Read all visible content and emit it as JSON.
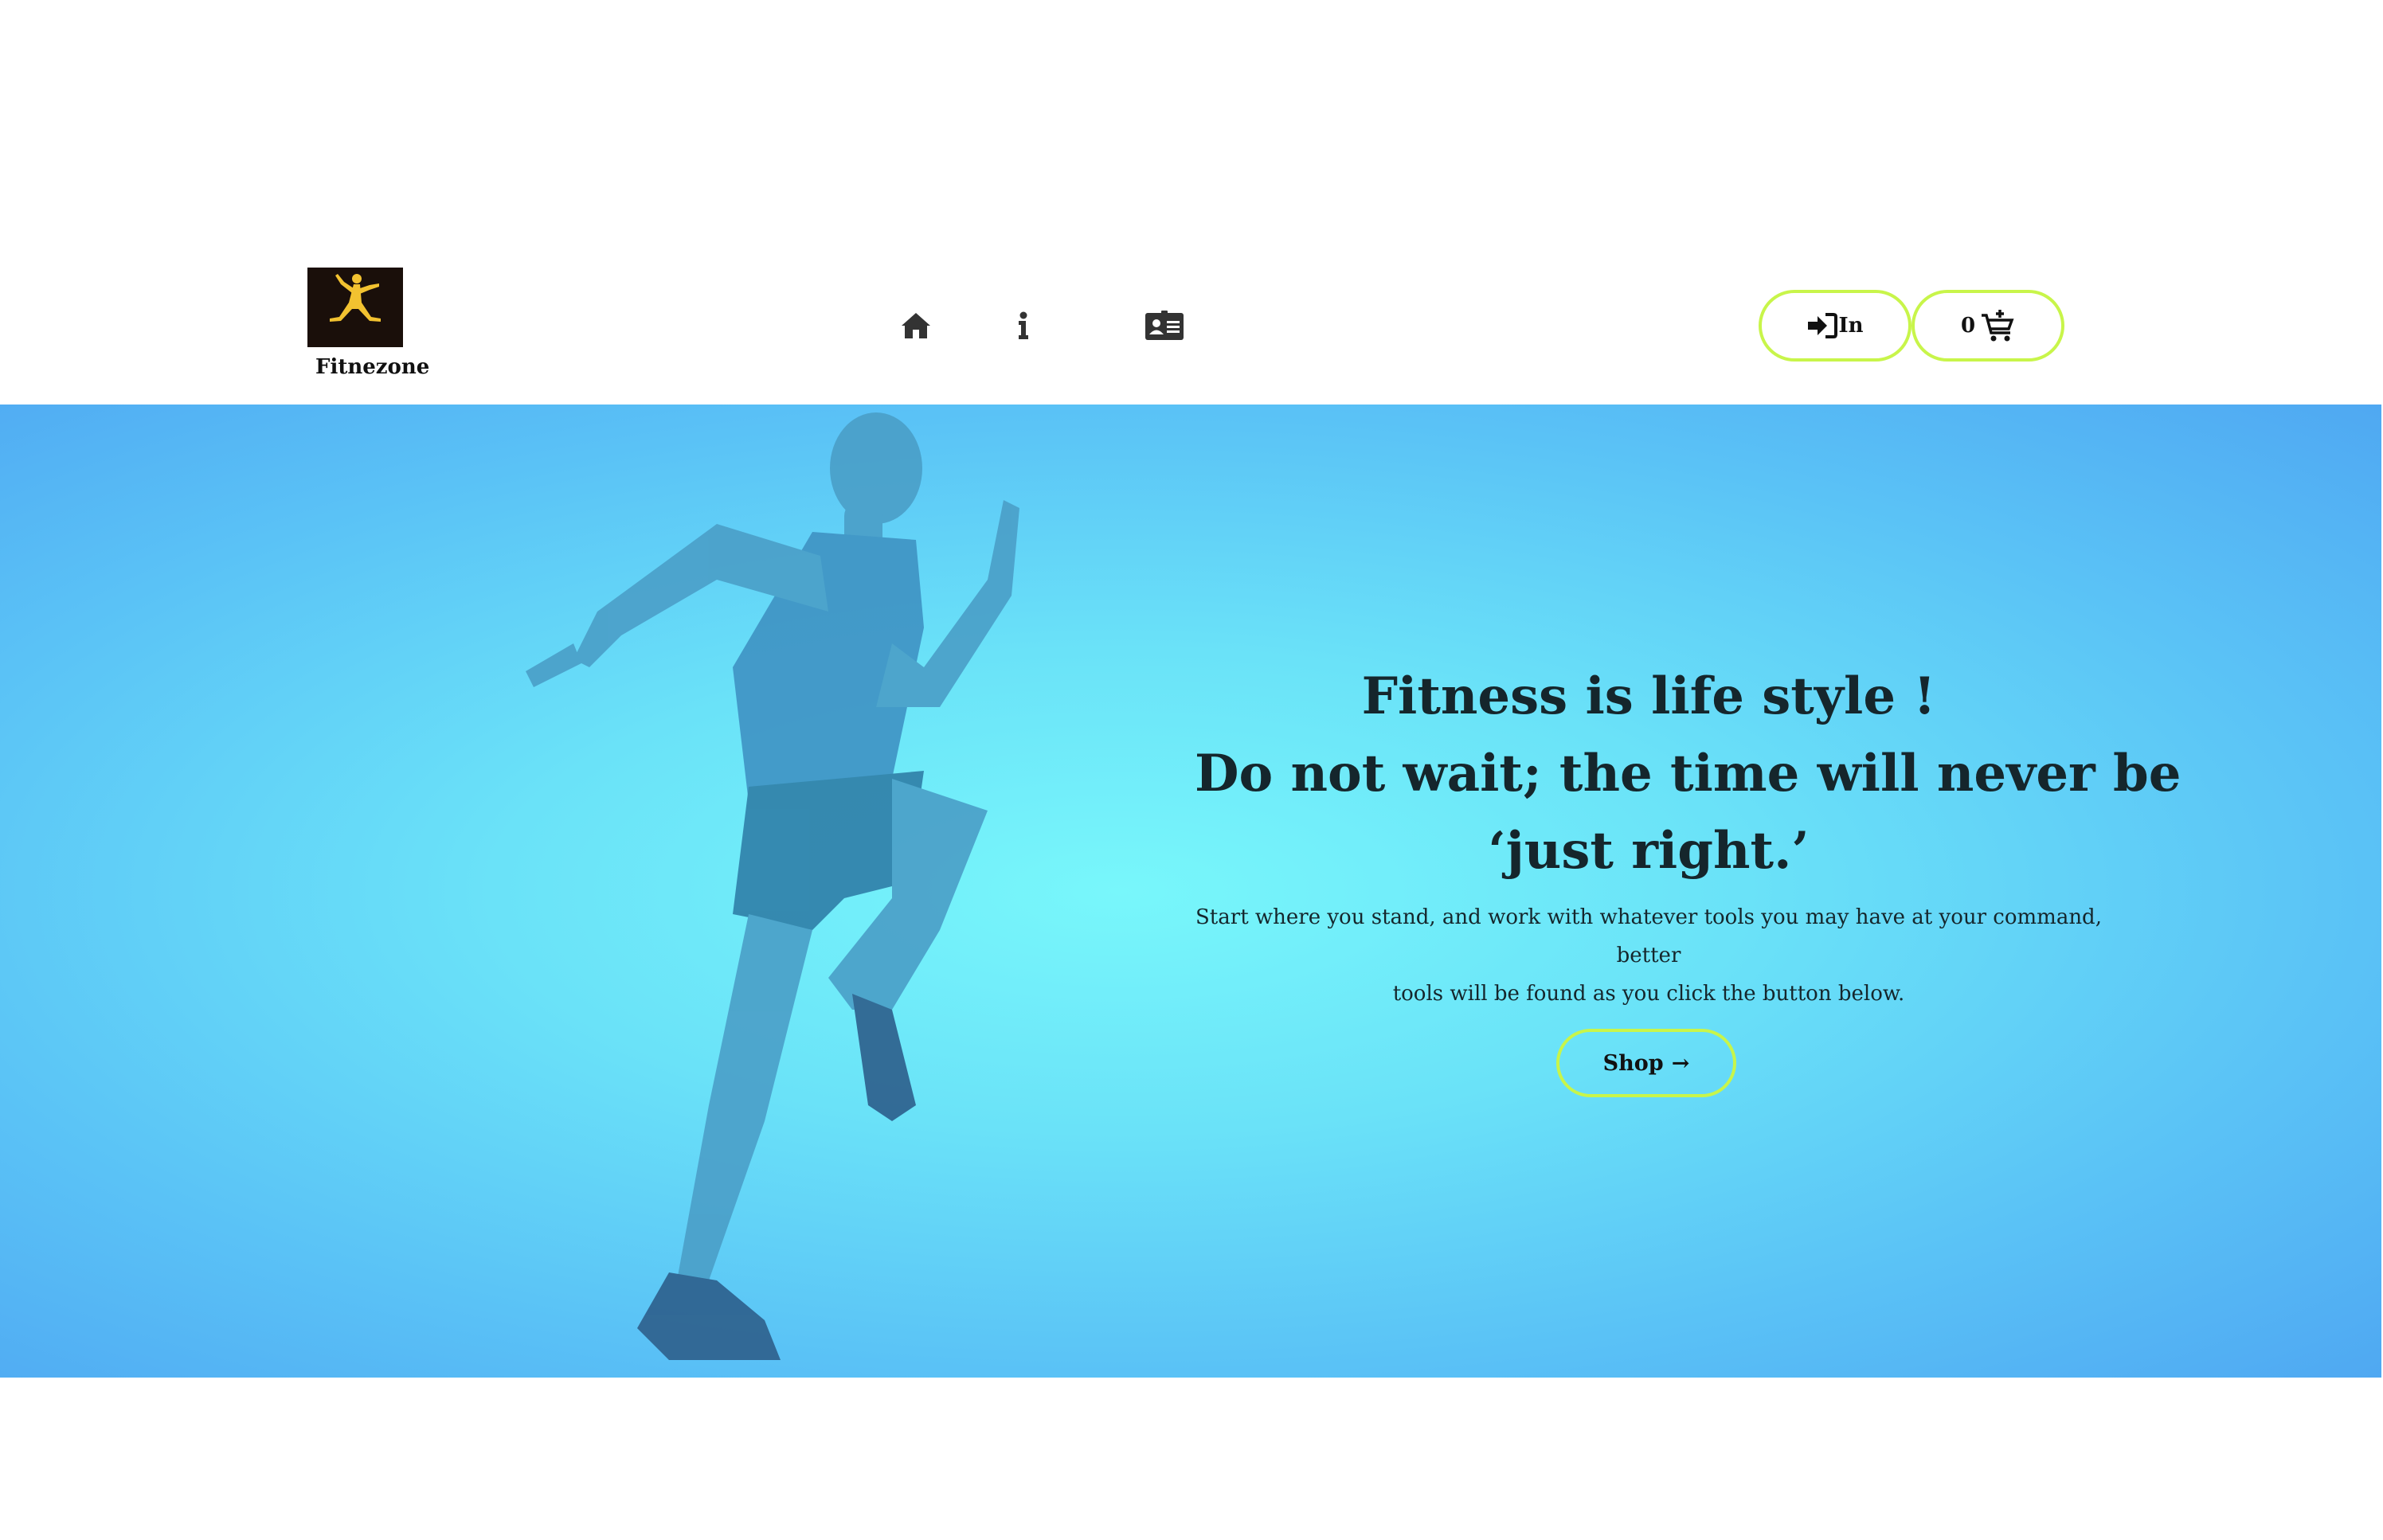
{
  "header": {
    "brand_name": "Fitnezone",
    "logo_icon": "jumpman-logo-icon",
    "nav": [
      {
        "icon": "home-icon"
      },
      {
        "icon": "info-icon"
      },
      {
        "icon": "contact-card-icon"
      }
    ],
    "login_label": "In",
    "login_icon": "sign-in-icon",
    "cart_count": "0",
    "cart_icon": "add-to-cart-icon"
  },
  "hero": {
    "headline_line1": "Fitness is life style !",
    "headline_line2": "Do not wait; the time will never be",
    "headline_line3": "‘just right.’",
    "subtext_line1": "Start where you stand, and work with whatever tools you may have at your command, better",
    "subtext_line2": "tools will be found as you click the button below.",
    "shop_label": "Shop",
    "shop_arrow": "→"
  },
  "colors": {
    "accent_border": "#c8f54a",
    "hero_center": "#78f7fb",
    "hero_edge": "#4fa8f2",
    "text_dark": "#15262c",
    "logo_bg": "#1a0f0a",
    "logo_figure": "#f2c230"
  }
}
